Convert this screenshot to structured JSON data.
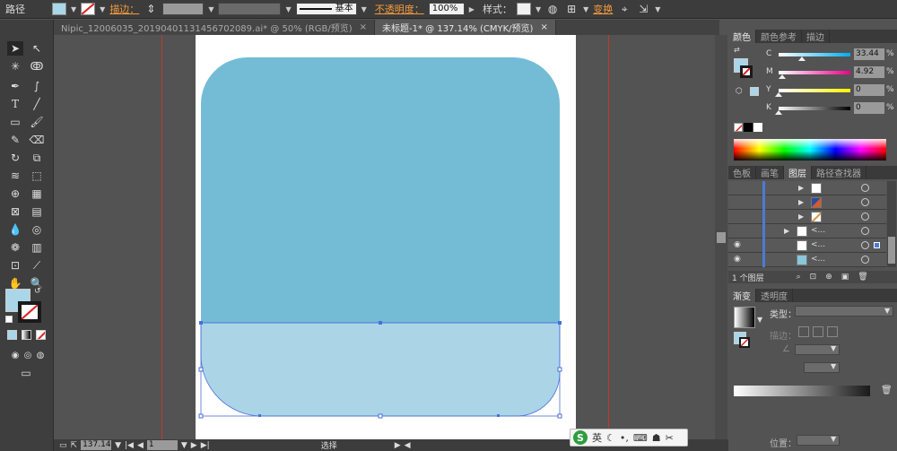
{
  "control_bar": {
    "object_type": "路径",
    "stroke_label": "描边：",
    "stroke_profile": "基本",
    "opacity_label": "不透明度：",
    "opacity_value": "100%",
    "style_label": "样式：",
    "transform_label": "变换"
  },
  "tabs": [
    {
      "label": "Nipic_12006035_20190401131456702089.ai* @ 50% (RGB/预览)",
      "active": false
    },
    {
      "label": "未标题-1* @ 137.14% (CMYK/预览)",
      "active": true
    }
  ],
  "color_panel": {
    "tabs": [
      "颜色",
      "颜色参考",
      "描边"
    ],
    "channels": [
      {
        "name": "C",
        "value": "33.44",
        "knob": 0.33,
        "track": "linear-gradient(to right,#fff,#00aeef)"
      },
      {
        "name": "M",
        "value": "4.92",
        "knob": 0.05,
        "track": "linear-gradient(to right,#fff,#ec008c)"
      },
      {
        "name": "Y",
        "value": "0",
        "knob": 0.0,
        "track": "linear-gradient(to right,#fff,#fff200)"
      },
      {
        "name": "K",
        "value": "0",
        "knob": 0.0,
        "track": "linear-gradient(to right,#fff,#000)"
      }
    ],
    "percent_sign": "%",
    "fill_color": "#a9d6e9"
  },
  "layers_panel": {
    "tabs": [
      "色板",
      "画笔",
      "图层",
      "路径查找器"
    ],
    "count_label": "1 个图层",
    "sublayer_name": "<...",
    "rows": [
      {
        "visible": false,
        "indent": 1,
        "thumb": "#ffffff"
      },
      {
        "visible": false,
        "indent": 1,
        "thumb": "#2b4c9c"
      },
      {
        "visible": false,
        "indent": 1,
        "thumb": "#d99a4a"
      },
      {
        "visible": false,
        "indent": 0,
        "thumb": "#ffffff"
      },
      {
        "visible": true,
        "indent": 0,
        "thumb": "#ffffff"
      },
      {
        "visible": true,
        "indent": 0,
        "thumb": "#8ac6dc"
      }
    ]
  },
  "gradient_panel": {
    "tabs": [
      "渐变",
      "透明度"
    ],
    "type_label": "类型：",
    "stroke_label": "描边：",
    "position_label": "位置："
  },
  "status_bar": {
    "zoom": "137.14",
    "artboard_num": "1",
    "tool_label": "选择"
  },
  "ime": {
    "logo": "S",
    "lang": "英"
  },
  "colors": {
    "shape_top": "#74bcd6",
    "shape_bottom": "#abd4e7",
    "selection": "#4a6fd8",
    "guide": "#c0392b"
  }
}
